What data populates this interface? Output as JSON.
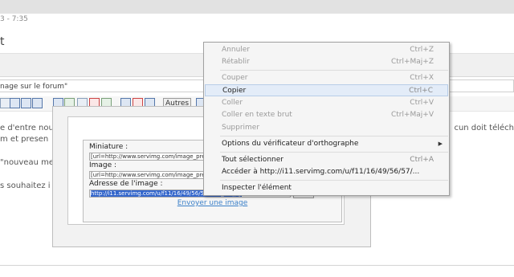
{
  "page": {
    "date": "3 - 7:35",
    "title": "t",
    "subject": "nage sur le forum\"",
    "autres": "Autres",
    "lines": [
      "e d'entre nou",
      "m et presen",
      "\"nouveau me",
      "s souhaitez i"
    ],
    "right_line": "cun doit téléch"
  },
  "dialog": {
    "miniature_label": "Miniature :",
    "miniature_value": "[url=http://www.servimg.com/image_prev",
    "image_label": "Image :",
    "image_value": "[url=http://www.servimg.com/image_prev",
    "adresse_label": "Adresse de l'image :",
    "adresse_value": "http://i11.servimg.com/u/f11/16/49/56/57/tutu_11.jpg",
    "copier_button": "Copier",
    "envoyer_link": "Envoyer une image"
  },
  "context_menu": {
    "items": [
      {
        "label": "Annuler",
        "shortcut": "Ctrl+Z",
        "enabled": false
      },
      {
        "label": "Rétablir",
        "shortcut": "Ctrl+Maj+Z",
        "enabled": false
      },
      {
        "label": "Couper",
        "shortcut": "Ctrl+X",
        "enabled": false
      },
      {
        "label": "Copier",
        "shortcut": "Ctrl+C",
        "enabled": true,
        "highlighted": true
      },
      {
        "label": "Coller",
        "shortcut": "Ctrl+V",
        "enabled": false
      },
      {
        "label": "Coller en texte brut",
        "shortcut": "Ctrl+Maj+V",
        "enabled": false
      },
      {
        "label": "Supprimer",
        "shortcut": "",
        "enabled": false
      },
      {
        "label": "Options du vérificateur d'orthographe",
        "shortcut": "",
        "enabled": true,
        "submenu": true
      },
      {
        "label": "Tout sélectionner",
        "shortcut": "Ctrl+A",
        "enabled": true
      },
      {
        "label": "Accéder à http://i11.servimg.com/u/f11/16/49/56/57/...",
        "shortcut": "",
        "enabled": true
      },
      {
        "label": "Inspecter l'élément",
        "shortcut": "",
        "enabled": true
      }
    ]
  },
  "colors": {
    "highlight": "#e3ecf8",
    "link": "#3a7fc8",
    "selection": "#3366cc"
  }
}
